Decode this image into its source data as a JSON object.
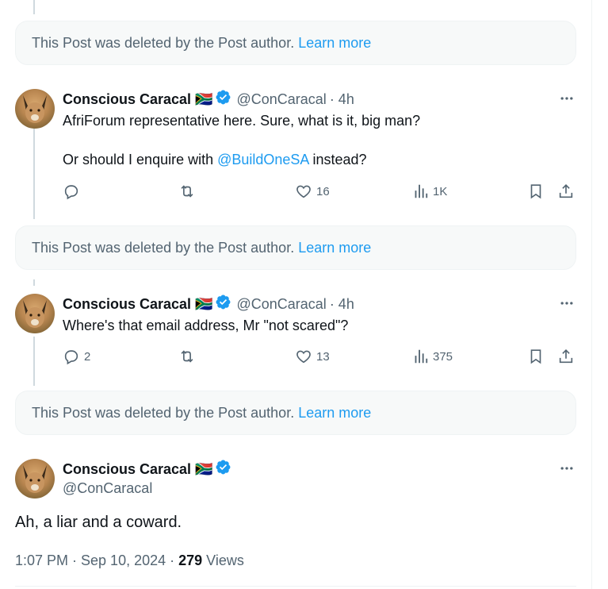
{
  "deleted_notice": {
    "text": "This Post was deleted by the Post author.",
    "learn_more": "Learn more"
  },
  "colors": {
    "accent": "#1d9bf0",
    "muted": "#536471",
    "text": "#0f1419",
    "verified": "#1d9bf0"
  },
  "replies": [
    {
      "name": "Conscious Caracal",
      "flag": "🇿🇦",
      "handle": "@ConCaracal",
      "time": "· 4h",
      "line1": "AfriForum representative here. Sure, what is it, big man?",
      "line2_pre": "Or should I enquire with ",
      "line2_mention": "@BuildOneSA",
      "line2_post": " instead?",
      "replies_count": "",
      "likes": "16",
      "views": "1K"
    },
    {
      "name": "Conscious Caracal",
      "flag": "🇿🇦",
      "handle": "@ConCaracal",
      "time": "· 4h",
      "line1": "Where's that email address, Mr \"not scared\"?",
      "replies_count": "2",
      "likes": "13",
      "views": "375"
    }
  ],
  "main_post": {
    "name": "Conscious Caracal",
    "flag": "🇿🇦",
    "handle": "@ConCaracal",
    "text": "Ah, a liar and a coward.",
    "timestamp": "1:07 PM · Sep 10, 2024 · ",
    "views_count": "279",
    "views_label": " Views"
  }
}
